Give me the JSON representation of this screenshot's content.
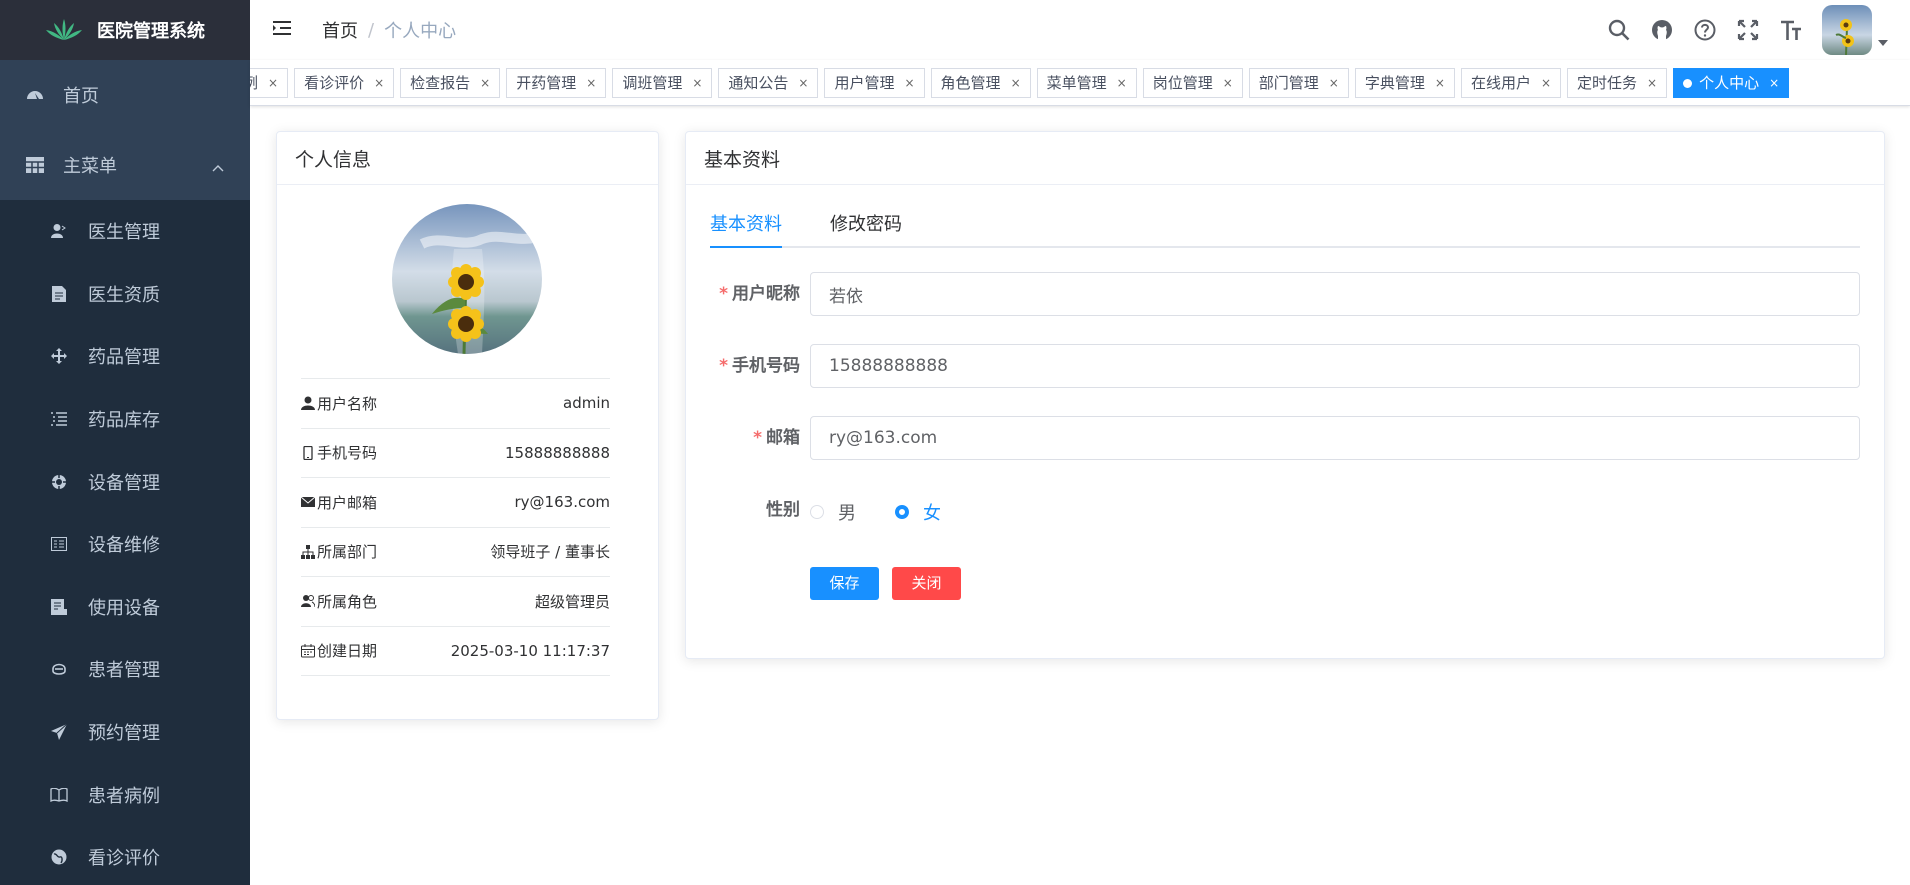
{
  "app": {
    "title": "医院管理系统"
  },
  "sidebar": {
    "home": "首页",
    "main_menu": "主菜单",
    "items": [
      {
        "label": "医生管理",
        "icon": "doctor-icon"
      },
      {
        "label": "医生资质",
        "icon": "document-icon"
      },
      {
        "label": "药品管理",
        "icon": "move-icon"
      },
      {
        "label": "药品库存",
        "icon": "list-icon"
      },
      {
        "label": "设备管理",
        "icon": "device-icon"
      },
      {
        "label": "设备维修",
        "icon": "repair-icon"
      },
      {
        "label": "使用设备",
        "icon": "use-device-icon"
      },
      {
        "label": "患者管理",
        "icon": "patient-icon"
      },
      {
        "label": "预约管理",
        "icon": "send-icon"
      },
      {
        "label": "患者病例",
        "icon": "book-icon"
      },
      {
        "label": "看诊评价",
        "icon": "globe-icon"
      }
    ]
  },
  "navbar": {
    "breadcrumb_home": "首页",
    "breadcrumb_sep": "/",
    "breadcrumb_current": "个人中心"
  },
  "tags": [
    "例",
    "看诊评价",
    "检查报告",
    "开药管理",
    "调班管理",
    "通知公告",
    "用户管理",
    "角色管理",
    "菜单管理",
    "岗位管理",
    "部门管理",
    "字典管理",
    "在线用户",
    "定时任务",
    "个人中心"
  ],
  "tags_close": "×",
  "profile": {
    "title": "个人信息",
    "rows": [
      {
        "label": "用户名称",
        "value": "admin"
      },
      {
        "label": "手机号码",
        "value": "15888888888"
      },
      {
        "label": "用户邮箱",
        "value": "ry@163.com"
      },
      {
        "label": "所属部门",
        "value": "领导班子 / 董事长"
      },
      {
        "label": "所属角色",
        "value": "超级管理员"
      },
      {
        "label": "创建日期",
        "value": "2025-03-10 11:17:37"
      }
    ]
  },
  "basic": {
    "title": "基本资料",
    "tabs": [
      "基本资料",
      "修改密码"
    ],
    "required_mark": "*",
    "nickname_label": "用户昵称",
    "nickname_value": "若依",
    "phone_label": "手机号码",
    "phone_value": "15888888888",
    "email_label": "邮箱",
    "email_value": "ry@163.com",
    "gender_label": "性别",
    "gender_male": "男",
    "gender_female": "女",
    "save": "保存",
    "close": "关闭"
  },
  "colors": {
    "primary": "#1890ff",
    "danger": "#ff4949",
    "sidebar": "#304156",
    "submenu": "#1f2d3d"
  }
}
